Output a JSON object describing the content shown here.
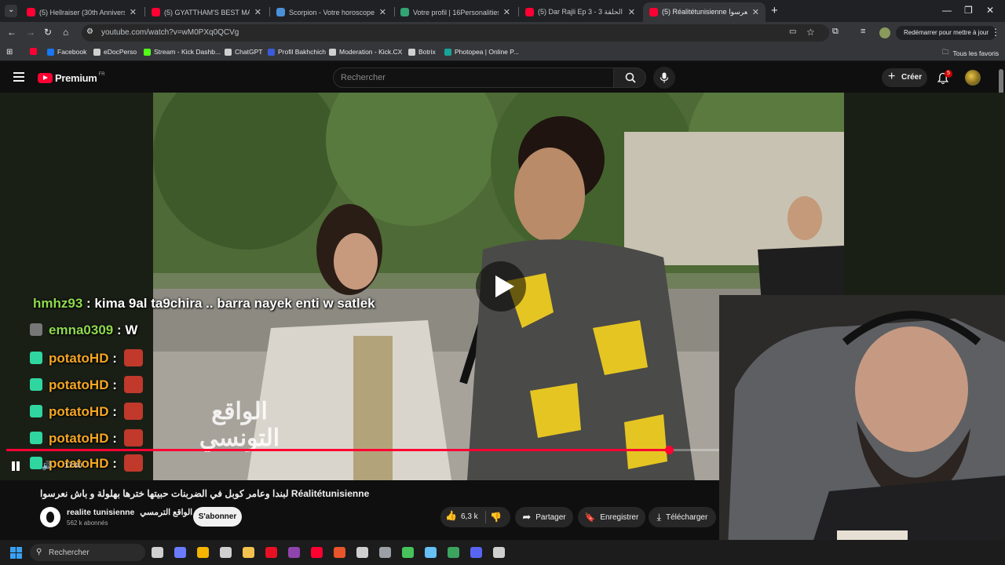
{
  "browser": {
    "tabs": [
      {
        "title": "(5) Hellraiser (30th Anniversary",
        "favicon_color": "#ff0033"
      },
      {
        "title": "(5) GYATTHAM'S BEST MAGIC RE",
        "favicon_color": "#ff0033"
      },
      {
        "title": "Scorpion - Votre horoscope du",
        "favicon_color": "#4a90d9"
      },
      {
        "title": "Votre profil | 16Personalities",
        "favicon_color": "#33a474"
      },
      {
        "title": "(5) Dar Rajli Ep 3 - 3 دار رجلي الحلقة",
        "favicon_color": "#ff0033"
      },
      {
        "title": "(5) Réalitétunisienne نعرسوا",
        "favicon_color": "#ff0033"
      }
    ],
    "new_tab_label": "+",
    "url": "youtube.com/watch?v=wM0PXq0QCVg",
    "restart_label": "Redémarrer pour mettre à jour",
    "bookmarks": [
      {
        "label": "",
        "color": "#ff0033"
      },
      {
        "label": "Facebook",
        "color": "#1877f2"
      },
      {
        "label": "eDocPerso",
        "color": "#cfcfcf"
      },
      {
        "label": "Stream - Kick Dashb...",
        "color": "#53fc18"
      },
      {
        "label": "ChatGPT",
        "color": "#cfcfcf"
      },
      {
        "label": "Profil Bakhchich",
        "color": "#3b5bdb"
      },
      {
        "label": "Moderation - Kick.CX",
        "color": "#cfcfcf"
      },
      {
        "label": "Botrix",
        "color": "#cfcfcf"
      },
      {
        "label": "Photopea | Online P...",
        "color": "#18a497"
      }
    ],
    "all_bookmarks_label": "Tous les favoris"
  },
  "youtube": {
    "logo_text": "Premium",
    "logo_region": "FR",
    "search_placeholder": "Rechercher",
    "create_label": "Créer",
    "notif_count": "5",
    "video_watermark": "الواقع التونسي",
    "video_title": "لبندا وعامر كوبل في الضربنات حبيتها خترها بهلولة و باش نعرسوا Réalitétunisienne",
    "channel_name": "realite tunisienne",
    "channel_name_ar": "الواقع الترمسي",
    "subscribers": "562 k abonnés",
    "subscribe_label": "S'abonner",
    "likes": "6,3 k",
    "share_label": "Partager",
    "save_label": "Enregistrer",
    "download_label": "Télécharger",
    "progress_fraction": 0.91,
    "time_label": "17:40"
  },
  "chat": [
    {
      "user": "hmhz93",
      "sep": " : ",
      "message": "kima 9al ta9chira .. barra nayek enti w satlek",
      "user_color": "#8fd94e"
    },
    {
      "user": "emna0309",
      "sep": " : ",
      "message": "W",
      "user_color": "#8fd94e"
    },
    {
      "user": "potatoHD",
      "sep": " : ",
      "message": "",
      "user_color": "#f5a623"
    },
    {
      "user": "potatoHD",
      "sep": " : ",
      "message": "",
      "user_color": "#f5a623"
    },
    {
      "user": "potatoHD",
      "sep": " : ",
      "message": "",
      "user_color": "#f5a623"
    },
    {
      "user": "potatoHD",
      "sep": " : ",
      "message": "",
      "user_color": "#f5a623"
    },
    {
      "user": "potatoHD",
      "sep": " : ",
      "message": "",
      "user_color": "#f5a623"
    }
  ],
  "taskbar": {
    "search_placeholder": "Rechercher",
    "apps": [
      {
        "name": "file-explorer",
        "color": "#cfcfcf"
      },
      {
        "name": "copilot",
        "color": "#6b7bff"
      },
      {
        "name": "chrome",
        "color": "#f4b400"
      },
      {
        "name": "store",
        "color": "#cfcfcf"
      },
      {
        "name": "folder",
        "color": "#f2c14e"
      },
      {
        "name": "app-red",
        "color": "#e81123"
      },
      {
        "name": "app-purple",
        "color": "#8e44ad"
      },
      {
        "name": "youtube",
        "color": "#ff0033"
      },
      {
        "name": "app-orange",
        "color": "#e8552a"
      },
      {
        "name": "obs",
        "color": "#cfcfcf"
      },
      {
        "name": "settings",
        "color": "#9aa0a6"
      },
      {
        "name": "app-green",
        "color": "#46c35b"
      },
      {
        "name": "steam",
        "color": "#66c0f4"
      },
      {
        "name": "app-green2",
        "color": "#3ba55d"
      },
      {
        "name": "discord",
        "color": "#5865f2"
      },
      {
        "name": "calculator",
        "color": "#cfcfcf"
      }
    ]
  }
}
